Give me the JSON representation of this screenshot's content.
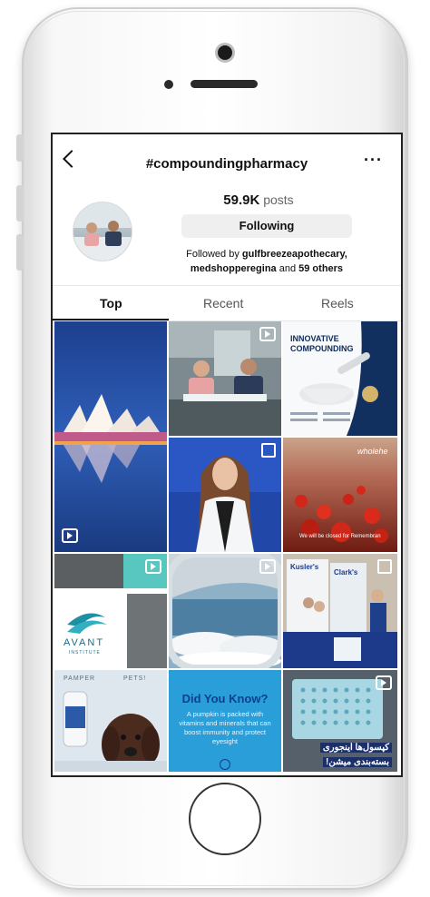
{
  "header": {
    "title": "#compoundingpharmacy",
    "more": "···"
  },
  "profile": {
    "posts_count": "59.9K",
    "posts_label": "posts",
    "follow_button": "Following",
    "followed_prefix": "Followed by ",
    "followed_by_1": "gulfbreezeapothecary,",
    "followed_by_2": "medshopperegina",
    "followed_and": " and ",
    "followed_others": "59 others"
  },
  "tabs": [
    {
      "label": "Top"
    },
    {
      "label": "Recent"
    },
    {
      "label": "Reels"
    }
  ],
  "posts": {
    "p3_title_1": "INNOVATIVE",
    "p3_title_2": "COMPOUNDING",
    "p6_brand": "wholehe",
    "p6_caption": "We will be closed for Remembran",
    "p7_logo": "AVANT",
    "p7_sub": "INSTITUTE",
    "p9_brand_1": "Kusler's",
    "p9_brand_2": "Clark's",
    "p10_header": "PAMPER",
    "p10_header_2": "PETS!",
    "p11_title": "Did You Know?",
    "p11_body": "A pumpkin is packed with vitamins and minerals that can boost immunity and protect eyesight",
    "p12_line_1": "کپسول‌ها اینجوری",
    "p12_line_2": "بسته‌بندی میشن!"
  },
  "colors": {
    "accent": "#1a73e8",
    "tab_active": "#111111"
  }
}
